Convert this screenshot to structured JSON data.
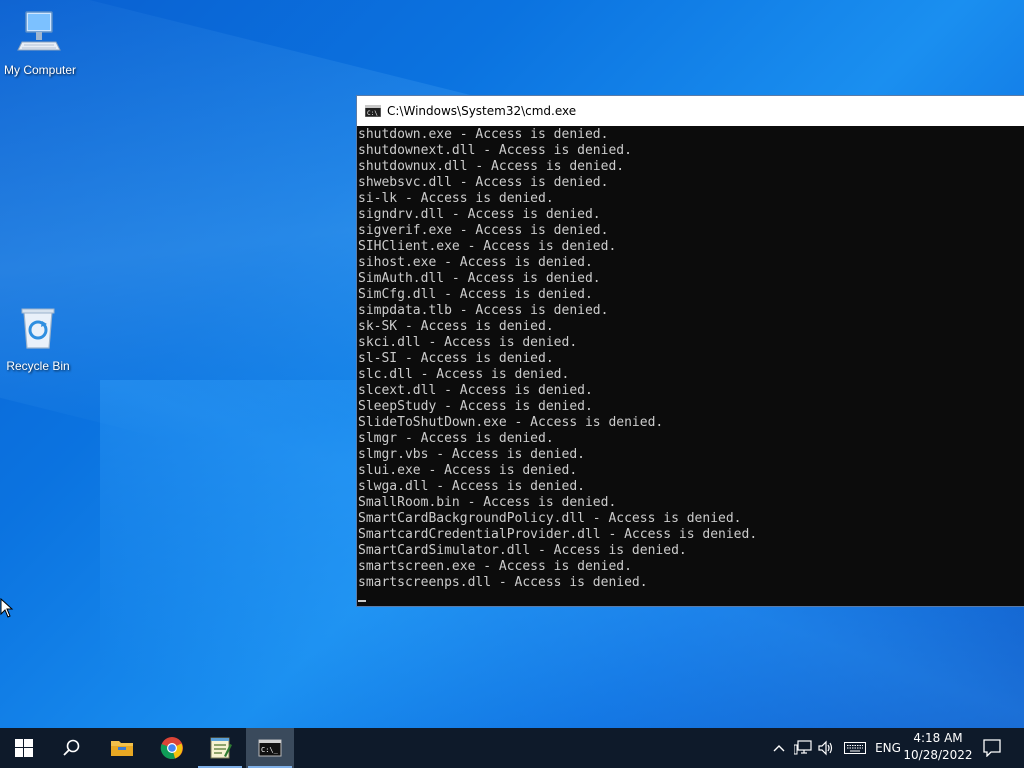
{
  "desktop": {
    "icons": [
      {
        "label": "My Computer",
        "icon": "computer-icon"
      },
      {
        "label": "Recycle Bin",
        "icon": "recycle-bin-icon"
      }
    ]
  },
  "cmd": {
    "title": "C:\\Windows\\System32\\cmd.exe",
    "lines": [
      "shutdown.exe - Access is denied.",
      "shutdownext.dll - Access is denied.",
      "shutdownux.dll - Access is denied.",
      "shwebsvc.dll - Access is denied.",
      "si-lk - Access is denied.",
      "signdrv.dll - Access is denied.",
      "sigverif.exe - Access is denied.",
      "SIHClient.exe - Access is denied.",
      "sihost.exe - Access is denied.",
      "SimAuth.dll - Access is denied.",
      "SimCfg.dll - Access is denied.",
      "simpdata.tlb - Access is denied.",
      "sk-SK - Access is denied.",
      "skci.dll - Access is denied.",
      "sl-SI - Access is denied.",
      "slc.dll - Access is denied.",
      "slcext.dll - Access is denied.",
      "SleepStudy - Access is denied.",
      "SlideToShutDown.exe - Access is denied.",
      "slmgr - Access is denied.",
      "slmgr.vbs - Access is denied.",
      "slui.exe - Access is denied.",
      "slwga.dll - Access is denied.",
      "SmallRoom.bin - Access is denied.",
      "SmartCardBackgroundPolicy.dll - Access is denied.",
      "SmartcardCredentialProvider.dll - Access is denied.",
      "SmartCardSimulator.dll - Access is denied.",
      "smartscreen.exe - Access is denied.",
      "smartscreenps.dll - Access is denied."
    ]
  },
  "taskbar": {
    "apps": [
      {
        "name": "start-button",
        "icon": "windows-logo-icon"
      },
      {
        "name": "search-button",
        "icon": "search-icon"
      },
      {
        "name": "file-explorer-button",
        "icon": "folder-icon"
      },
      {
        "name": "chrome-button",
        "icon": "chrome-icon"
      },
      {
        "name": "notepad-button",
        "icon": "notepad-icon"
      },
      {
        "name": "cmd-taskbar-button",
        "icon": "cmd-icon",
        "active": true
      }
    ],
    "tray": {
      "language": "ENG",
      "time": "4:18 AM",
      "date": "10/28/2022"
    }
  },
  "colors": {
    "console_bg": "#0c0c0c",
    "console_fg": "#cccccc",
    "taskbar_bg": "#0e1a2a",
    "desktop_accent": "#0b73e0"
  }
}
